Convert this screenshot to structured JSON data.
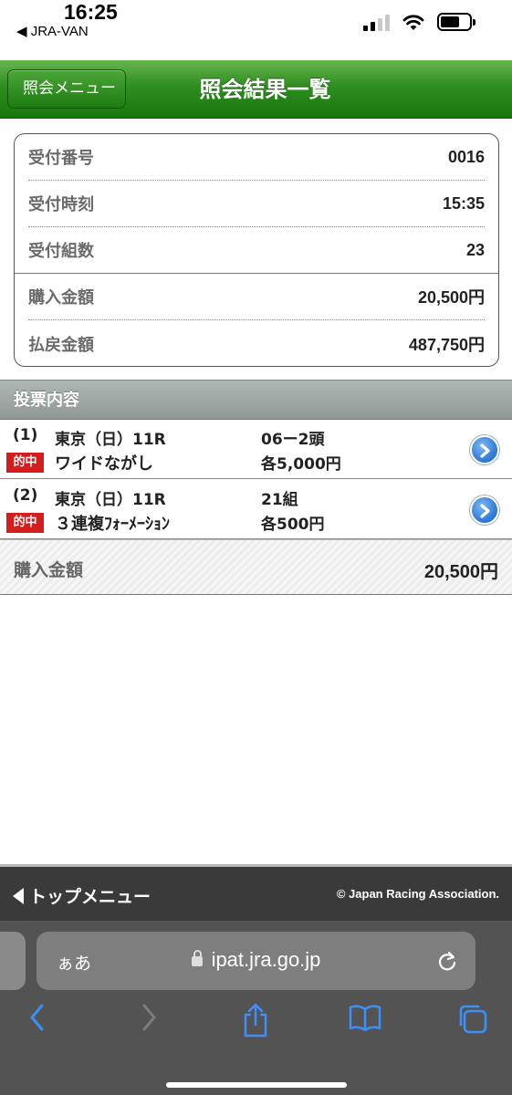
{
  "status_bar": {
    "time": "16:25",
    "back_app": "◀ JRA-VAN"
  },
  "header": {
    "back_label": "照会メニュー",
    "title": "照会結果一覧"
  },
  "summary": [
    {
      "label": "受付番号",
      "value": "0016"
    },
    {
      "label": "受付時刻",
      "value": "15:35"
    },
    {
      "label": "受付組数",
      "value": "23"
    },
    {
      "label": "購入金額",
      "value": "20,500円"
    },
    {
      "label": "払戻金額",
      "value": "487,750円"
    }
  ],
  "votes_section": {
    "title": "投票内容"
  },
  "votes": [
    {
      "number": "(1)",
      "venue": "東京（日）11R",
      "detail": "06ー2頭",
      "badge": "的中",
      "bet_type": "ワイドながし",
      "amount": "各5,000円"
    },
    {
      "number": "(2)",
      "venue": "東京（日）11R",
      "detail": "21組",
      "badge": "的中",
      "bet_type": "３連複ﾌｫｰﾒｰｼｮﾝ",
      "amount": "各500円"
    }
  ],
  "total": {
    "label": "購入金額",
    "value": "20,500円"
  },
  "footer": {
    "top_menu": "トップメニュー",
    "copyright": "© Japan Racing Association."
  },
  "browser": {
    "aa": "ぁあ",
    "domain": "ipat.jra.go.jp"
  },
  "colors": {
    "header_green": "#2f8e1f",
    "hit_red": "#d41e1e",
    "link_blue": "#2a74d4"
  },
  "icons": [
    "signal-icon",
    "wifi-icon",
    "battery-icon",
    "chevron-right-icon",
    "lock-icon",
    "reload-icon",
    "back-icon",
    "forward-icon",
    "share-icon",
    "bookmarks-icon",
    "tabs-icon"
  ]
}
